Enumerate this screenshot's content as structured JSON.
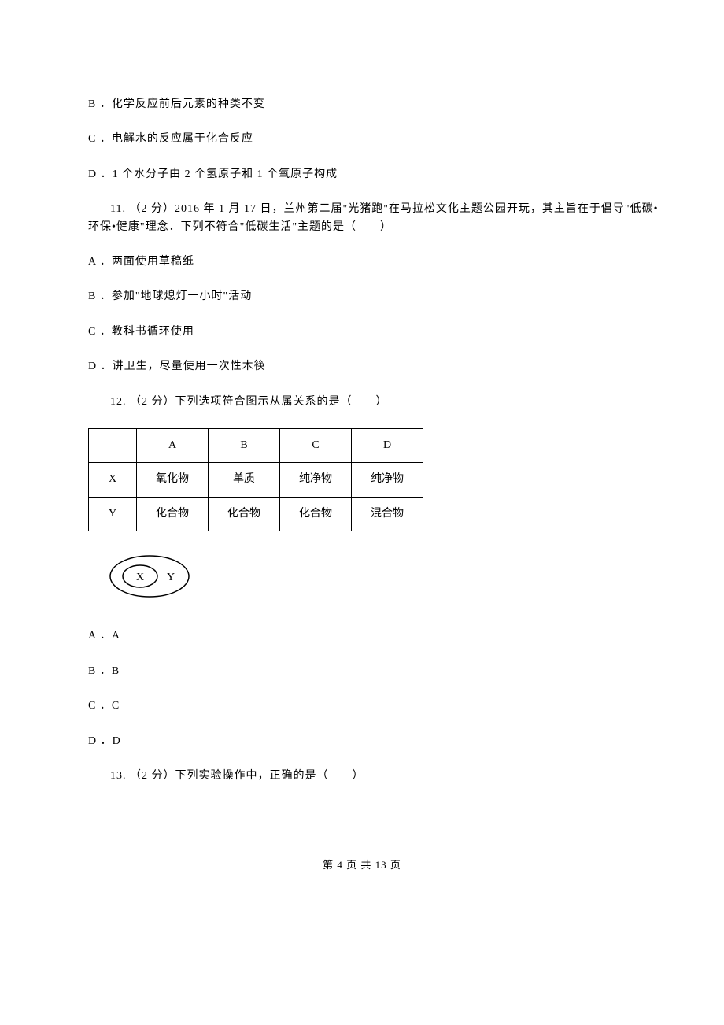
{
  "options_top": {
    "b": "B ．化学反应前后元素的种类不变",
    "c": "C ．电解水的反应属于化合反应",
    "d": "D ．1 个水分子由 2 个氢原子和 1 个氧原子构成"
  },
  "q11": {
    "text": "11. （2 分）2016 年 1 月 17 日，兰州第二届\"光猪跑\"在马拉松文化主题公园开玩，其主旨在于倡导\"低碳•环保•健康\"理念．下列不符合\"低碳生活\"主题的是（　　）",
    "a": "A ．两面使用草稿纸",
    "b": "B ．参加\"地球熄灯一小时\"活动",
    "c": "C ．教科书循环使用",
    "d": "D ．讲卫生，尽量使用一次性木筷"
  },
  "q12": {
    "text": "12. （2 分）下列选项符合图示从属关系的是（　　）",
    "table": {
      "header": [
        "",
        "A",
        "B",
        "C",
        "D"
      ],
      "rows": [
        [
          "X",
          "氧化物",
          "单质",
          "纯净物",
          "纯净物"
        ],
        [
          "Y",
          "化合物",
          "化合物",
          "化合物",
          "混合物"
        ]
      ]
    },
    "diagram": {
      "inner": "X",
      "outer": "Y"
    },
    "a": "A ．A",
    "b": "B ．B",
    "c": "C ．C",
    "d": "D ．D"
  },
  "q13": {
    "text": "13. （2 分）下列实验操作中，正确的是（　　）"
  },
  "footer": "第 4 页 共 13 页"
}
